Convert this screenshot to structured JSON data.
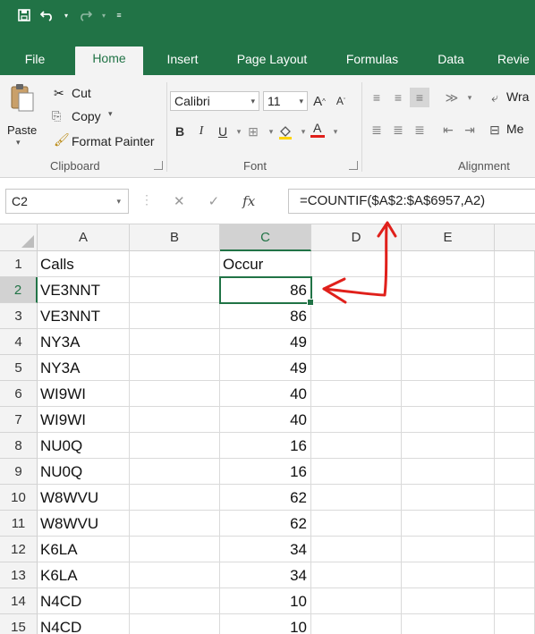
{
  "qat": {
    "save_icon": "save-icon",
    "undo_icon": "undo-icon",
    "redo_icon": "redo-icon",
    "customize_icon": "customize-icon"
  },
  "tabs": [
    {
      "label": "File",
      "active": false
    },
    {
      "label": "Home",
      "active": true
    },
    {
      "label": "Insert",
      "active": false
    },
    {
      "label": "Page Layout",
      "active": false
    },
    {
      "label": "Formulas",
      "active": false
    },
    {
      "label": "Data",
      "active": false
    },
    {
      "label": "Revie",
      "active": false
    }
  ],
  "clipboard": {
    "group_label": "Clipboard",
    "paste_label": "Paste",
    "cut_label": "Cut",
    "copy_label": "Copy",
    "format_painter_label": "Format Painter"
  },
  "font": {
    "group_label": "Font",
    "font_name": "Calibri",
    "font_size": "11",
    "bold": "B",
    "italic": "I",
    "underline": "U",
    "grow": "A",
    "shrink": "A"
  },
  "alignment": {
    "group_label": "Alignment",
    "wrap_label": "Wra",
    "merge_label": "Me"
  },
  "formula_bar": {
    "name_box": "C2",
    "fx": "fx",
    "formula": "=COUNTIF($A$2:$A$6957,A2)"
  },
  "colors": {
    "accent": "#217346",
    "annotation": "#e0201b"
  },
  "columns": [
    "A",
    "B",
    "C",
    "D",
    "E"
  ],
  "selected_column": "C",
  "selected_row": 2,
  "rows": [
    {
      "n": "1",
      "a": "Calls",
      "c": "Occur"
    },
    {
      "n": "2",
      "a": "VE3NNT",
      "c": "86"
    },
    {
      "n": "3",
      "a": "VE3NNT",
      "c": "86"
    },
    {
      "n": "4",
      "a": "NY3A",
      "c": "49"
    },
    {
      "n": "5",
      "a": "NY3A",
      "c": "49"
    },
    {
      "n": "6",
      "a": "WI9WI",
      "c": "40"
    },
    {
      "n": "7",
      "a": "WI9WI",
      "c": "40"
    },
    {
      "n": "8",
      "a": "NU0Q",
      "c": "16"
    },
    {
      "n": "9",
      "a": "NU0Q",
      "c": "16"
    },
    {
      "n": "10",
      "a": "W8WVU",
      "c": "62"
    },
    {
      "n": "11",
      "a": "W8WVU",
      "c": "62"
    },
    {
      "n": "12",
      "a": "K6LA",
      "c": "34"
    },
    {
      "n": "13",
      "a": "K6LA",
      "c": "34"
    },
    {
      "n": "14",
      "a": "N4CD",
      "c": "10"
    },
    {
      "n": "15",
      "a": "N4CD",
      "c": "10"
    }
  ]
}
